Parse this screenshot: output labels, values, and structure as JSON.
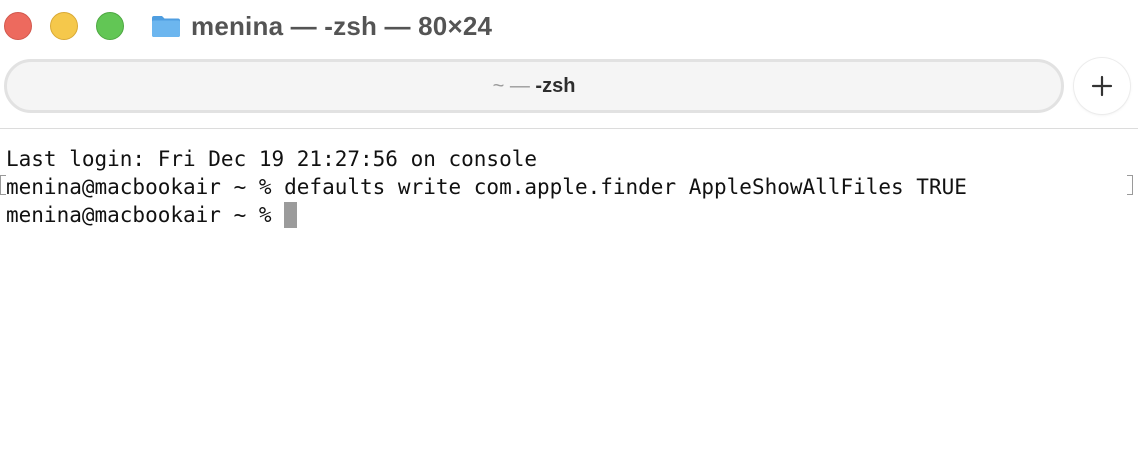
{
  "window": {
    "title": "menina — -zsh — 80×24",
    "folder_icon": "folder-icon"
  },
  "tabs": [
    {
      "prefix": "~ —",
      "label": "-zsh"
    }
  ],
  "new_tab": {
    "icon": "plus-icon"
  },
  "terminal": {
    "lines": [
      "Last login: Fri Dec 19 21:27:56 on console",
      "menina@macbookair ~ % defaults write com.apple.finder AppleShowAllFiles TRUE",
      "menina@macbookair ~ % "
    ]
  },
  "colors": {
    "close": "#ed6a5e",
    "minimize": "#f5c84b",
    "maximize": "#62c655",
    "folder": "#5aa9e6"
  }
}
